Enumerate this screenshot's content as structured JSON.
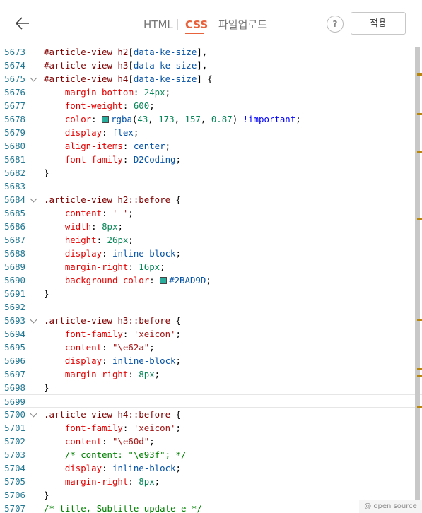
{
  "header": {
    "tabs": [
      {
        "label": "HTML",
        "active": false
      },
      {
        "label": "CSS",
        "active": true
      },
      {
        "label": "파일업로드",
        "active": false
      }
    ],
    "separator": "|",
    "help_label": "?",
    "apply_label": "적용"
  },
  "editor": {
    "lines": [
      {
        "n": "5673",
        "fold": false,
        "guide": false,
        "cur": false,
        "t": [
          [
            "sel",
            "#article-view h2"
          ],
          [
            "pun",
            "["
          ],
          [
            "val",
            "data-ke-size"
          ],
          [
            "pun",
            "],"
          ]
        ]
      },
      {
        "n": "5674",
        "fold": false,
        "guide": false,
        "cur": false,
        "t": [
          [
            "sel",
            "#article-view h3"
          ],
          [
            "pun",
            "["
          ],
          [
            "val",
            "data-ke-size"
          ],
          [
            "pun",
            "],"
          ]
        ]
      },
      {
        "n": "5675",
        "fold": true,
        "guide": false,
        "cur": false,
        "t": [
          [
            "sel",
            "#article-view h4"
          ],
          [
            "pun",
            "["
          ],
          [
            "val",
            "data-ke-size"
          ],
          [
            "pun",
            "] {"
          ]
        ]
      },
      {
        "n": "5676",
        "fold": false,
        "guide": true,
        "cur": false,
        "t": [
          [
            "prop",
            "    margin-bottom"
          ],
          [
            "pun",
            ": "
          ],
          [
            "num",
            "24px"
          ],
          [
            "pun",
            ";"
          ]
        ]
      },
      {
        "n": "5677",
        "fold": false,
        "guide": true,
        "cur": false,
        "t": [
          [
            "prop",
            "    font-weight"
          ],
          [
            "pun",
            ": "
          ],
          [
            "num",
            "600"
          ],
          [
            "pun",
            ";"
          ]
        ]
      },
      {
        "n": "5678",
        "fold": false,
        "guide": true,
        "cur": false,
        "t": [
          [
            "prop",
            "    color"
          ],
          [
            "pun",
            ": "
          ],
          [
            "swatch",
            "#2BAD9D"
          ],
          [
            "val",
            "rgba"
          ],
          [
            "pun",
            "("
          ],
          [
            "num",
            "43"
          ],
          [
            "pun",
            ", "
          ],
          [
            "num",
            "173"
          ],
          [
            "pun",
            ", "
          ],
          [
            "num",
            "157"
          ],
          [
            "pun",
            ", "
          ],
          [
            "num",
            "0.87"
          ],
          [
            "pun",
            ") "
          ],
          [
            "kw",
            "!important"
          ],
          [
            "pun",
            ";"
          ]
        ]
      },
      {
        "n": "5679",
        "fold": false,
        "guide": true,
        "cur": false,
        "t": [
          [
            "prop",
            "    display"
          ],
          [
            "pun",
            ": "
          ],
          [
            "val",
            "flex"
          ],
          [
            "pun",
            ";"
          ]
        ]
      },
      {
        "n": "5680",
        "fold": false,
        "guide": true,
        "cur": false,
        "t": [
          [
            "prop",
            "    align-items"
          ],
          [
            "pun",
            ": "
          ],
          [
            "val",
            "center"
          ],
          [
            "pun",
            ";"
          ]
        ]
      },
      {
        "n": "5681",
        "fold": false,
        "guide": true,
        "cur": false,
        "t": [
          [
            "prop",
            "    font-family"
          ],
          [
            "pun",
            ": "
          ],
          [
            "val",
            "D2Coding"
          ],
          [
            "pun",
            ";"
          ]
        ]
      },
      {
        "n": "5682",
        "fold": false,
        "guide": false,
        "cur": false,
        "t": [
          [
            "pun",
            "}"
          ]
        ]
      },
      {
        "n": "5683",
        "fold": false,
        "guide": false,
        "cur": false,
        "t": []
      },
      {
        "n": "5684",
        "fold": true,
        "guide": false,
        "cur": false,
        "t": [
          [
            "sel",
            ".article-view h2::before"
          ],
          [
            "pun",
            " {"
          ]
        ]
      },
      {
        "n": "5685",
        "fold": false,
        "guide": true,
        "cur": false,
        "t": [
          [
            "prop",
            "    content"
          ],
          [
            "pun",
            ": "
          ],
          [
            "str",
            "' '"
          ],
          [
            "pun",
            ";"
          ]
        ]
      },
      {
        "n": "5686",
        "fold": false,
        "guide": true,
        "cur": false,
        "t": [
          [
            "prop",
            "    width"
          ],
          [
            "pun",
            ": "
          ],
          [
            "num",
            "8px"
          ],
          [
            "pun",
            ";"
          ]
        ]
      },
      {
        "n": "5687",
        "fold": false,
        "guide": true,
        "cur": false,
        "t": [
          [
            "prop",
            "    height"
          ],
          [
            "pun",
            ": "
          ],
          [
            "num",
            "26px"
          ],
          [
            "pun",
            ";"
          ]
        ]
      },
      {
        "n": "5688",
        "fold": false,
        "guide": true,
        "cur": false,
        "t": [
          [
            "prop",
            "    display"
          ],
          [
            "pun",
            ": "
          ],
          [
            "val",
            "inline-block"
          ],
          [
            "pun",
            ";"
          ]
        ]
      },
      {
        "n": "5689",
        "fold": false,
        "guide": true,
        "cur": false,
        "t": [
          [
            "prop",
            "    margin-right"
          ],
          [
            "pun",
            ": "
          ],
          [
            "num",
            "16px"
          ],
          [
            "pun",
            ";"
          ]
        ]
      },
      {
        "n": "5690",
        "fold": false,
        "guide": true,
        "cur": false,
        "t": [
          [
            "prop",
            "    background-color"
          ],
          [
            "pun",
            ": "
          ],
          [
            "swatch",
            "#2BAD9D"
          ],
          [
            "val",
            "#2BAD9D"
          ],
          [
            "pun",
            ";"
          ]
        ]
      },
      {
        "n": "5691",
        "fold": false,
        "guide": false,
        "cur": false,
        "t": [
          [
            "pun",
            "}"
          ]
        ]
      },
      {
        "n": "5692",
        "fold": false,
        "guide": false,
        "cur": false,
        "t": []
      },
      {
        "n": "5693",
        "fold": true,
        "guide": false,
        "cur": false,
        "t": [
          [
            "sel",
            ".article-view h3::before"
          ],
          [
            "pun",
            " {"
          ]
        ]
      },
      {
        "n": "5694",
        "fold": false,
        "guide": true,
        "cur": false,
        "t": [
          [
            "prop",
            "    font-family"
          ],
          [
            "pun",
            ": "
          ],
          [
            "str",
            "'xeicon'"
          ],
          [
            "pun",
            ";"
          ]
        ]
      },
      {
        "n": "5695",
        "fold": false,
        "guide": true,
        "cur": false,
        "t": [
          [
            "prop",
            "    content"
          ],
          [
            "pun",
            ": "
          ],
          [
            "str",
            "\"\\e62a\""
          ],
          [
            "pun",
            ";"
          ]
        ]
      },
      {
        "n": "5696",
        "fold": false,
        "guide": true,
        "cur": false,
        "t": [
          [
            "prop",
            "    display"
          ],
          [
            "pun",
            ": "
          ],
          [
            "val",
            "inline-block"
          ],
          [
            "pun",
            ";"
          ]
        ]
      },
      {
        "n": "5697",
        "fold": false,
        "guide": true,
        "cur": false,
        "t": [
          [
            "prop",
            "    margin-right"
          ],
          [
            "pun",
            ": "
          ],
          [
            "num",
            "8px"
          ],
          [
            "pun",
            ";"
          ]
        ]
      },
      {
        "n": "5698",
        "fold": false,
        "guide": false,
        "cur": false,
        "t": [
          [
            "pun",
            "}"
          ]
        ]
      },
      {
        "n": "5699",
        "fold": false,
        "guide": false,
        "cur": true,
        "t": []
      },
      {
        "n": "5700",
        "fold": true,
        "guide": false,
        "cur": false,
        "t": [
          [
            "sel",
            ".article-view h4::before"
          ],
          [
            "pun",
            " {"
          ]
        ]
      },
      {
        "n": "5701",
        "fold": false,
        "guide": true,
        "cur": false,
        "t": [
          [
            "prop",
            "    font-family"
          ],
          [
            "pun",
            ": "
          ],
          [
            "str",
            "'xeicon'"
          ],
          [
            "pun",
            ";"
          ]
        ]
      },
      {
        "n": "5702",
        "fold": false,
        "guide": true,
        "cur": false,
        "t": [
          [
            "prop",
            "    content"
          ],
          [
            "pun",
            ": "
          ],
          [
            "str",
            "\"\\e60d\""
          ],
          [
            "pun",
            ";"
          ]
        ]
      },
      {
        "n": "5703",
        "fold": false,
        "guide": true,
        "cur": false,
        "t": [
          [
            "cmt",
            "    /* content: \"\\e93f\"; */"
          ]
        ]
      },
      {
        "n": "5704",
        "fold": false,
        "guide": true,
        "cur": false,
        "t": [
          [
            "prop",
            "    display"
          ],
          [
            "pun",
            ": "
          ],
          [
            "val",
            "inline-block"
          ],
          [
            "pun",
            ";"
          ]
        ]
      },
      {
        "n": "5705",
        "fold": false,
        "guide": true,
        "cur": false,
        "t": [
          [
            "prop",
            "    margin-right"
          ],
          [
            "pun",
            ": "
          ],
          [
            "num",
            "8px"
          ],
          [
            "pun",
            ";"
          ]
        ]
      },
      {
        "n": "5706",
        "fold": false,
        "guide": false,
        "cur": false,
        "t": [
          [
            "pun",
            "}"
          ]
        ]
      },
      {
        "n": "5707",
        "fold": false,
        "guide": false,
        "cur": false,
        "t": [
          [
            "cmt",
            "/* title, Subtitle update e */"
          ]
        ]
      }
    ]
  },
  "scrollbar_marks": [
    0.06,
    0.145,
    0.225,
    0.37,
    0.585,
    0.69,
    0.705,
    0.77
  ],
  "footer": {
    "badge": "@ open source"
  },
  "colors": {
    "accent": "#e8623b",
    "swatch": "#2BAD9D"
  }
}
